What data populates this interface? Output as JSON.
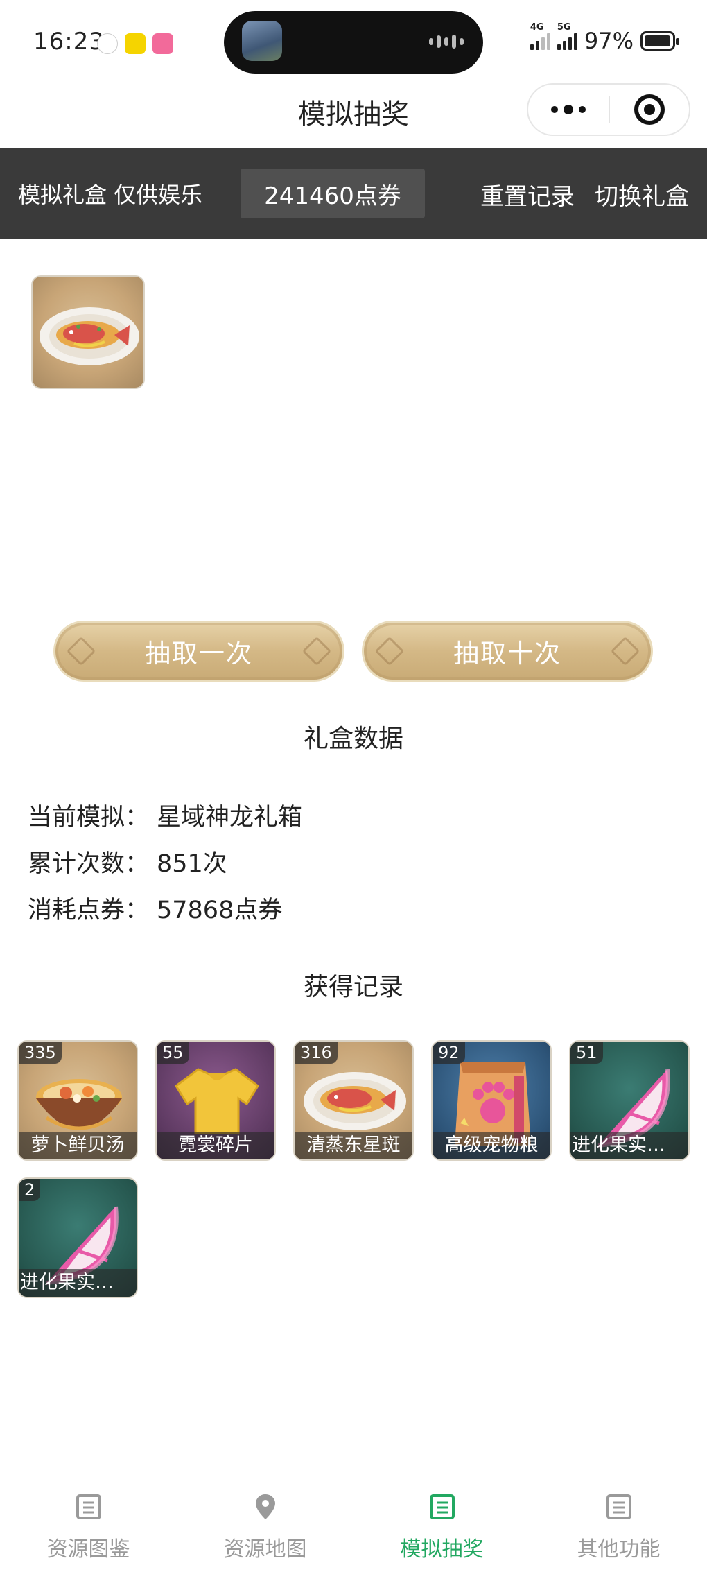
{
  "status_bar": {
    "time": "16:23",
    "network_1": "4G",
    "network_2": "5G",
    "battery": "97%"
  },
  "header": {
    "title": "模拟抽奖"
  },
  "toolbar": {
    "label": "模拟礼盒 仅供娱乐",
    "points": "241460点券",
    "reset_label": "重置记录",
    "switch_label": "切换礼盒"
  },
  "draw_buttons": {
    "once": "抽取一次",
    "ten": "抽取十次"
  },
  "box_data": {
    "title": "礼盒数据",
    "rows": [
      {
        "key": "当前模拟：",
        "value": "星域神龙礼箱"
      },
      {
        "key": "累计次数：",
        "value": "851次"
      },
      {
        "key": "消耗点券：",
        "value": "57868点券"
      }
    ]
  },
  "records": {
    "title": "获得记录",
    "items": [
      {
        "count": "335",
        "name": "萝卜鲜贝汤",
        "icon": "soup-bowl-icon"
      },
      {
        "count": "55",
        "name": "霓裳碎片",
        "icon": "shirt-icon"
      },
      {
        "count": "316",
        "name": "清蒸东星斑",
        "icon": "steamed-fish-icon"
      },
      {
        "count": "92",
        "name": "高级宠物粮",
        "icon": "pet-food-bag-icon"
      },
      {
        "count": "51",
        "name": "进化果实…",
        "icon": "evolution-fruit-icon"
      },
      {
        "count": "2",
        "name": "进化果实…",
        "icon": "evolution-fruit-icon"
      }
    ]
  },
  "bottom_nav": [
    {
      "label": "资源图鉴",
      "icon": "book-icon",
      "active": false
    },
    {
      "label": "资源地图",
      "icon": "map-pin-icon",
      "active": false
    },
    {
      "label": "模拟抽奖",
      "icon": "lottery-icon",
      "active": true
    },
    {
      "label": "其他功能",
      "icon": "more-icon",
      "active": false
    }
  ],
  "colors": {
    "toolbar_bg": "#3a3a3a",
    "accent_active": "#22a861",
    "inactive": "#9a9a9a"
  }
}
